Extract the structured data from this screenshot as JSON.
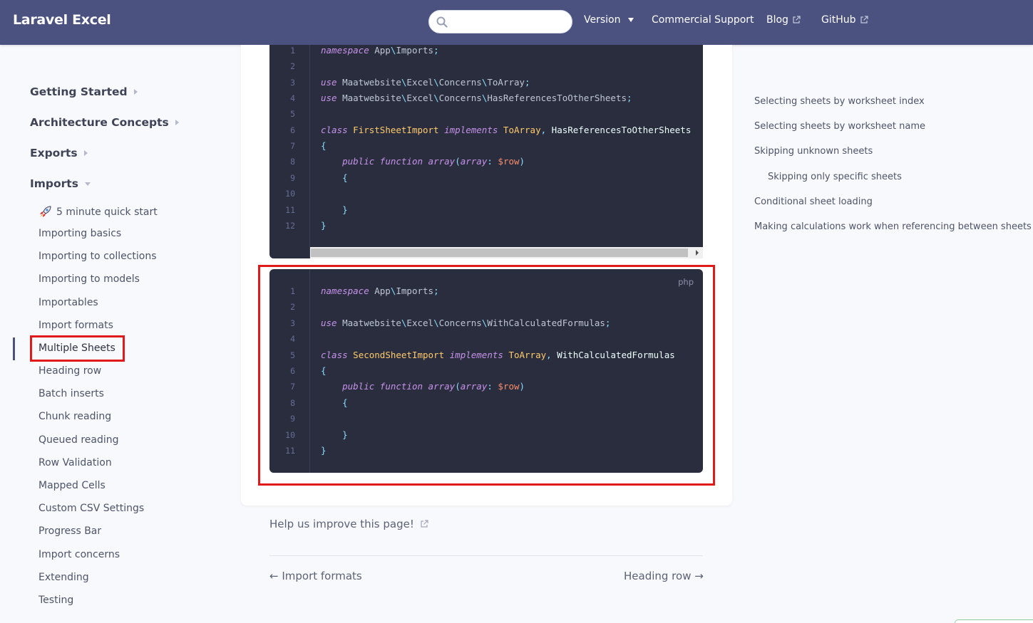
{
  "header": {
    "brand": "Laravel Excel",
    "search_placeholder": "",
    "nav": {
      "version": "Version",
      "support": "Commercial Support",
      "blog": "Blog",
      "github": "GitHub"
    }
  },
  "sidebar": {
    "sections": [
      "Getting Started",
      "Architecture Concepts",
      "Exports",
      "Imports"
    ],
    "imports_items": [
      "5 minute quick start",
      "Importing basics",
      "Importing to collections",
      "Importing to models",
      "Importables",
      "Import formats",
      "Multiple Sheets",
      "Heading row",
      "Batch inserts",
      "Chunk reading",
      "Queued reading",
      "Row Validation",
      "Mapped Cells",
      "Custom CSV Settings",
      "Progress Bar",
      "Import concerns",
      "Extending",
      "Testing"
    ],
    "active_item": "Multiple Sheets"
  },
  "code1": {
    "line_numbers": [
      "1",
      "2",
      "3",
      "4",
      "5",
      "6",
      "7",
      "8",
      "9",
      "10",
      "11",
      "12"
    ]
  },
  "code2": {
    "language": "php",
    "line_numbers": [
      "1",
      "2",
      "3",
      "4",
      "5",
      "6",
      "7",
      "8",
      "9",
      "10",
      "11"
    ]
  },
  "footer": {
    "help": "Help us improve this page!",
    "prev": "← Import formats",
    "next": "Heading row →"
  },
  "toc": [
    "Selecting sheets by worksheet index",
    "Selecting sheets by worksheet name",
    "Skipping unknown sheets",
    "Skipping only specific sheets",
    "Conditional sheet loading",
    "Making calculations work when referencing between sheets"
  ],
  "colors": {
    "header_bg": "#4b5280",
    "code_bg": "#292d3e",
    "highlight": "#e01a1a"
  }
}
